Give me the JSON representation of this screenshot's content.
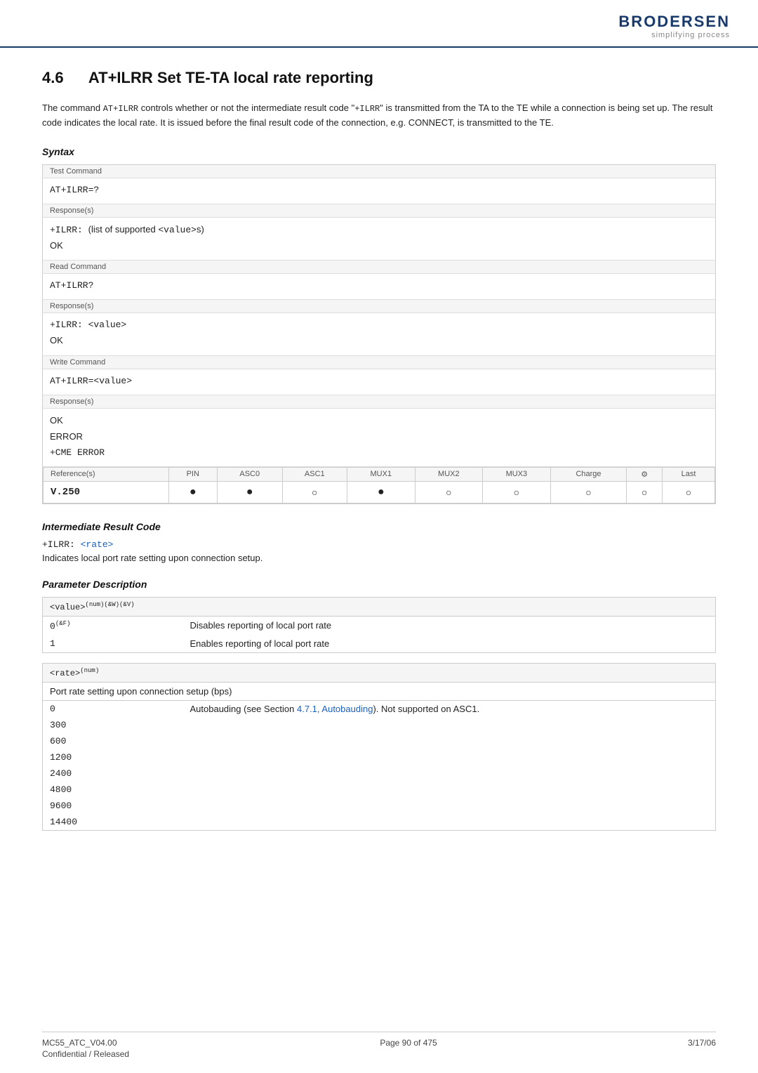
{
  "header": {
    "logo_name": "BRODERSEN",
    "logo_tagline": "simplifying process"
  },
  "section": {
    "number": "4.6",
    "title": "AT+ILRR   Set TE-TA local rate reporting"
  },
  "body_text": "The command AT+ILRR controls whether or not the intermediate result code \"+ILRR\" is transmitted from the TA to the TE while a connection is being set up. The result code indicates the local rate. It is issued before the final result code of the connection, e.g. CONNECT, is transmitted to the TE.",
  "syntax": {
    "heading": "Syntax",
    "test_command_label": "Test Command",
    "test_command_cmd": "AT+ILRR=?",
    "test_command_response_label": "Response(s)",
    "test_command_response": "+ILRR: (list of supported <value>s)",
    "test_command_ok": "OK",
    "read_command_label": "Read Command",
    "read_command_cmd": "AT+ILRR?",
    "read_command_response_label": "Response(s)",
    "read_command_response": "+ILRR: <value>",
    "read_command_ok": "OK",
    "write_command_label": "Write Command",
    "write_command_cmd": "AT+ILRR=<value>",
    "write_command_response_label": "Response(s)",
    "write_command_ok": "OK",
    "write_command_error": "ERROR",
    "write_command_cme": "+CME ERROR",
    "reference_label": "Reference(s)",
    "reference_value": "V.250",
    "columns": [
      "PIN",
      "ASC0",
      "ASC1",
      "MUX1",
      "MUX2",
      "MUX3",
      "Charge",
      "⚙",
      "Last"
    ],
    "row_circles": [
      "filled",
      "filled",
      "empty",
      "filled",
      "empty",
      "empty",
      "empty",
      "empty",
      "empty"
    ]
  },
  "intermediate": {
    "heading": "Intermediate Result Code",
    "code": "+ILRR: <rate>",
    "description": "Indicates local port rate setting upon connection setup."
  },
  "parameter_description": {
    "heading": "Parameter Description",
    "value_header": "<value>(num)(&W)(&V)",
    "value_rows": [
      {
        "value": "0(&F)",
        "description": "Disables reporting of local port rate"
      },
      {
        "value": "1",
        "description": "Enables reporting of local port rate"
      }
    ],
    "rate_header": "<rate>(num)",
    "rate_desc": "Port rate setting upon connection setup (bps)",
    "rate_rows": [
      {
        "value": "0",
        "description": "Autobauding (see Section 4.7.1, Autobauding). Not supported on ASC1."
      },
      {
        "value": "300",
        "description": ""
      },
      {
        "value": "600",
        "description": ""
      },
      {
        "value": "1200",
        "description": ""
      },
      {
        "value": "2400",
        "description": ""
      },
      {
        "value": "4800",
        "description": ""
      },
      {
        "value": "9600",
        "description": ""
      },
      {
        "value": "14400",
        "description": ""
      }
    ]
  },
  "footer": {
    "left_top": "MC55_ATC_V04.00",
    "left_bottom": "Confidential / Released",
    "center": "Page 90 of 475",
    "right": "3/17/06"
  }
}
